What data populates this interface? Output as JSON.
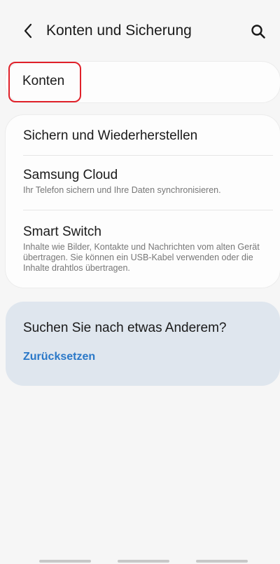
{
  "header": {
    "title": "Konten und Sicherung"
  },
  "sections": {
    "konten": {
      "label": "Konten"
    },
    "items": [
      {
        "title": "Sichern und Wiederherstellen",
        "subtitle": ""
      },
      {
        "title": "Samsung Cloud",
        "subtitle": "Ihr Telefon sichern und Ihre Daten synchronisieren."
      },
      {
        "title": "Smart Switch",
        "subtitle": "Inhalte wie Bilder, Kontakte und Nachrichten vom alten Gerät übertragen. Sie können ein USB-Kabel verwenden oder die Inhalte drahtlos übertragen."
      }
    ]
  },
  "suggest": {
    "title": "Suchen Sie nach etwas Anderem?",
    "link": "Zurücksetzen"
  },
  "icons": {
    "back": "chevron-left-icon",
    "search": "search-icon"
  },
  "colors": {
    "accent_link": "#2a78c8",
    "highlight": "#e0212a",
    "suggest_bg": "#dfe6ee"
  }
}
